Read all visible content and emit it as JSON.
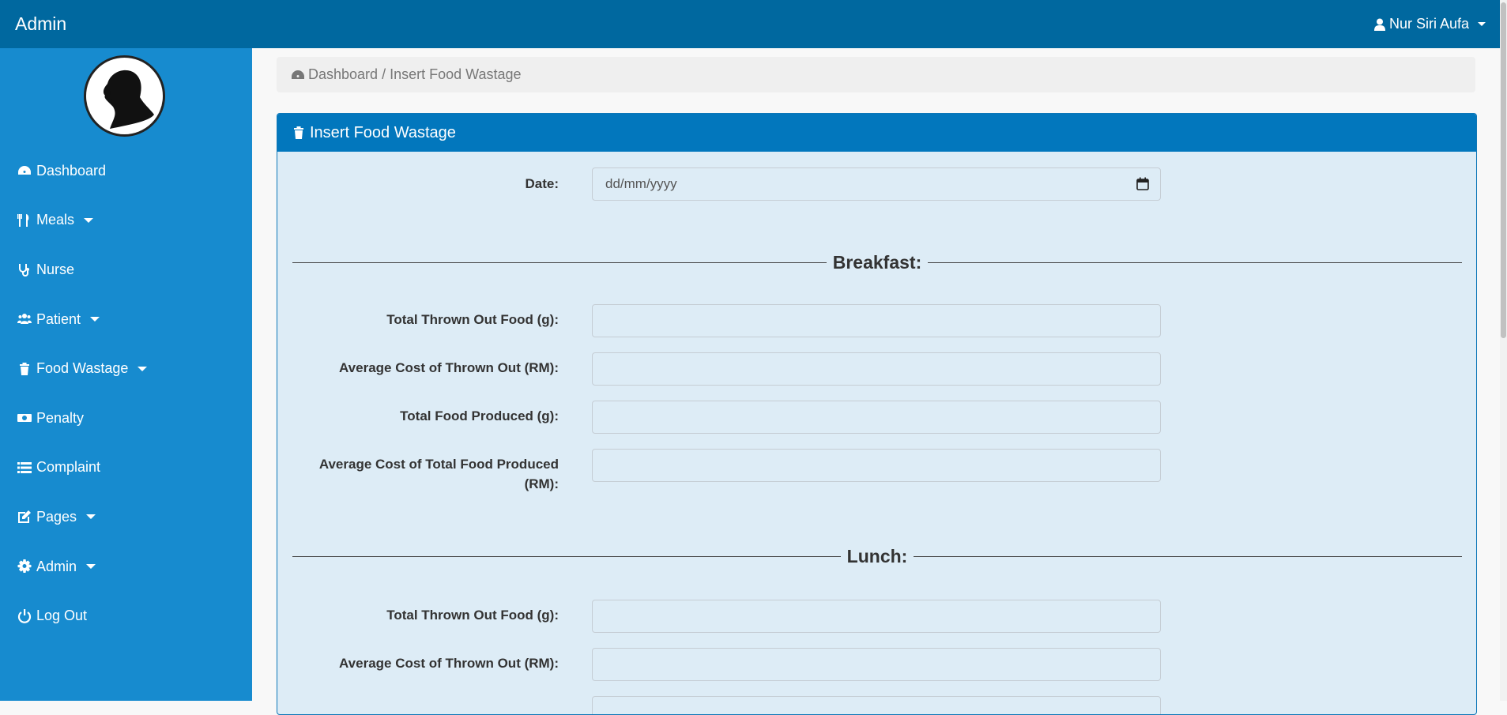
{
  "topbar": {
    "brand": "Admin",
    "user_name": "Nur Siri Aufa"
  },
  "sidebar": {
    "items": [
      {
        "label": "Dashboard",
        "icon": "dashboard-icon",
        "has_caret": false
      },
      {
        "label": "Meals",
        "icon": "cutlery-icon",
        "has_caret": true
      },
      {
        "label": "Nurse",
        "icon": "stethoscope-icon",
        "has_caret": false
      },
      {
        "label": "Patient",
        "icon": "users-icon",
        "has_caret": true
      },
      {
        "label": "Food Wastage",
        "icon": "trash-icon",
        "has_caret": true
      },
      {
        "label": "Penalty",
        "icon": "money-icon",
        "has_caret": false
      },
      {
        "label": "Complaint",
        "icon": "list-icon",
        "has_caret": false
      },
      {
        "label": "Pages",
        "icon": "edit-icon",
        "has_caret": true
      },
      {
        "label": "Admin",
        "icon": "gear-icon",
        "has_caret": true
      },
      {
        "label": "Log Out",
        "icon": "power-icon",
        "has_caret": false
      }
    ]
  },
  "breadcrumb": {
    "home": "Dashboard",
    "separator": "/",
    "current": "Insert Food Wastage"
  },
  "panel": {
    "title": "Insert Food Wastage"
  },
  "form": {
    "date_label": "Date:",
    "date_placeholder": "dd/mm/yyyy",
    "breakfast": {
      "title": "Breakfast:",
      "fields": [
        "Total Thrown Out Food (g):",
        "Average Cost of Thrown Out (RM):",
        "Total Food Produced (g):",
        "Average Cost of Total Food Produced (RM):"
      ]
    },
    "lunch": {
      "title": "Lunch:",
      "fields": [
        "Total Thrown Out Food (g):",
        "Average Cost of Thrown Out (RM):"
      ]
    }
  },
  "colors": {
    "topbar": "#00689f",
    "sidebar": "#178bcf",
    "panel_heading": "#0277bd",
    "panel_body": "#ddecf6"
  }
}
